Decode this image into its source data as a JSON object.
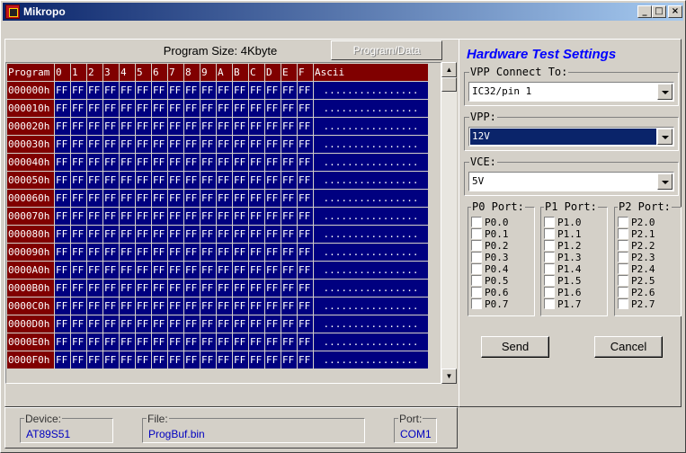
{
  "window": {
    "title": "Mikropo"
  },
  "program": {
    "size_label": "Program Size: 4Kbyte",
    "mode_button": "Program/Data",
    "headers": [
      "Program",
      "0",
      "1",
      "2",
      "3",
      "4",
      "5",
      "6",
      "7",
      "8",
      "9",
      "A",
      "B",
      "C",
      "D",
      "E",
      "F",
      "Ascii"
    ],
    "rows": [
      {
        "addr": "000000h",
        "bytes": [
          "FF",
          "FF",
          "FF",
          "FF",
          "FF",
          "FF",
          "FF",
          "FF",
          "FF",
          "FF",
          "FF",
          "FF",
          "FF",
          "FF",
          "FF",
          "FF"
        ],
        "ascii": "................"
      },
      {
        "addr": "000010h",
        "bytes": [
          "FF",
          "FF",
          "FF",
          "FF",
          "FF",
          "FF",
          "FF",
          "FF",
          "FF",
          "FF",
          "FF",
          "FF",
          "FF",
          "FF",
          "FF",
          "FF"
        ],
        "ascii": "................"
      },
      {
        "addr": "000020h",
        "bytes": [
          "FF",
          "FF",
          "FF",
          "FF",
          "FF",
          "FF",
          "FF",
          "FF",
          "FF",
          "FF",
          "FF",
          "FF",
          "FF",
          "FF",
          "FF",
          "FF"
        ],
        "ascii": "................"
      },
      {
        "addr": "000030h",
        "bytes": [
          "FF",
          "FF",
          "FF",
          "FF",
          "FF",
          "FF",
          "FF",
          "FF",
          "FF",
          "FF",
          "FF",
          "FF",
          "FF",
          "FF",
          "FF",
          "FF"
        ],
        "ascii": "................"
      },
      {
        "addr": "000040h",
        "bytes": [
          "FF",
          "FF",
          "FF",
          "FF",
          "FF",
          "FF",
          "FF",
          "FF",
          "FF",
          "FF",
          "FF",
          "FF",
          "FF",
          "FF",
          "FF",
          "FF"
        ],
        "ascii": "................"
      },
      {
        "addr": "000050h",
        "bytes": [
          "FF",
          "FF",
          "FF",
          "FF",
          "FF",
          "FF",
          "FF",
          "FF",
          "FF",
          "FF",
          "FF",
          "FF",
          "FF",
          "FF",
          "FF",
          "FF"
        ],
        "ascii": "................"
      },
      {
        "addr": "000060h",
        "bytes": [
          "FF",
          "FF",
          "FF",
          "FF",
          "FF",
          "FF",
          "FF",
          "FF",
          "FF",
          "FF",
          "FF",
          "FF",
          "FF",
          "FF",
          "FF",
          "FF"
        ],
        "ascii": "................"
      },
      {
        "addr": "000070h",
        "bytes": [
          "FF",
          "FF",
          "FF",
          "FF",
          "FF",
          "FF",
          "FF",
          "FF",
          "FF",
          "FF",
          "FF",
          "FF",
          "FF",
          "FF",
          "FF",
          "FF"
        ],
        "ascii": "................"
      },
      {
        "addr": "000080h",
        "bytes": [
          "FF",
          "FF",
          "FF",
          "FF",
          "FF",
          "FF",
          "FF",
          "FF",
          "FF",
          "FF",
          "FF",
          "FF",
          "FF",
          "FF",
          "FF",
          "FF"
        ],
        "ascii": "................"
      },
      {
        "addr": "000090h",
        "bytes": [
          "FF",
          "FF",
          "FF",
          "FF",
          "FF",
          "FF",
          "FF",
          "FF",
          "FF",
          "FF",
          "FF",
          "FF",
          "FF",
          "FF",
          "FF",
          "FF"
        ],
        "ascii": "................"
      },
      {
        "addr": "0000A0h",
        "bytes": [
          "FF",
          "FF",
          "FF",
          "FF",
          "FF",
          "FF",
          "FF",
          "FF",
          "FF",
          "FF",
          "FF",
          "FF",
          "FF",
          "FF",
          "FF",
          "FF"
        ],
        "ascii": "................"
      },
      {
        "addr": "0000B0h",
        "bytes": [
          "FF",
          "FF",
          "FF",
          "FF",
          "FF",
          "FF",
          "FF",
          "FF",
          "FF",
          "FF",
          "FF",
          "FF",
          "FF",
          "FF",
          "FF",
          "FF"
        ],
        "ascii": "................"
      },
      {
        "addr": "0000C0h",
        "bytes": [
          "FF",
          "FF",
          "FF",
          "FF",
          "FF",
          "FF",
          "FF",
          "FF",
          "FF",
          "FF",
          "FF",
          "FF",
          "FF",
          "FF",
          "FF",
          "FF"
        ],
        "ascii": "................"
      },
      {
        "addr": "0000D0h",
        "bytes": [
          "FF",
          "FF",
          "FF",
          "FF",
          "FF",
          "FF",
          "FF",
          "FF",
          "FF",
          "FF",
          "FF",
          "FF",
          "FF",
          "FF",
          "FF",
          "FF"
        ],
        "ascii": "................"
      },
      {
        "addr": "0000E0h",
        "bytes": [
          "FF",
          "FF",
          "FF",
          "FF",
          "FF",
          "FF",
          "FF",
          "FF",
          "FF",
          "FF",
          "FF",
          "FF",
          "FF",
          "FF",
          "FF",
          "FF"
        ],
        "ascii": "................"
      },
      {
        "addr": "0000F0h",
        "bytes": [
          "FF",
          "FF",
          "FF",
          "FF",
          "FF",
          "FF",
          "FF",
          "FF",
          "FF",
          "FF",
          "FF",
          "FF",
          "FF",
          "FF",
          "FF",
          "FF"
        ],
        "ascii": "................"
      }
    ]
  },
  "info": {
    "device_label": "Device:",
    "device_value": "AT89S51",
    "file_label": "File:",
    "file_value": "ProgBuf.bin",
    "port_label": "Port:",
    "port_value": "COM1"
  },
  "hardware": {
    "title": "Hardware Test Settings",
    "vpp_connect_label": "VPP Connect To:",
    "vpp_connect_value": "IC32/pin 1",
    "vpp_label": "VPP:",
    "vpp_value": "12V",
    "vce_label": "VCE:",
    "vce_value": "5V",
    "ports": [
      {
        "label": "P0 Port:",
        "pins": [
          "P0.0",
          "P0.1",
          "P0.2",
          "P0.3",
          "P0.4",
          "P0.5",
          "P0.6",
          "P0.7"
        ]
      },
      {
        "label": "P1 Port:",
        "pins": [
          "P1.0",
          "P1.1",
          "P1.2",
          "P1.3",
          "P1.4",
          "P1.5",
          "P1.6",
          "P1.7"
        ]
      },
      {
        "label": "P2 Port:",
        "pins": [
          "P2.0",
          "P2.1",
          "P2.2",
          "P2.3",
          "P2.4",
          "P2.5",
          "P2.6",
          "P2.7"
        ]
      }
    ],
    "send_label": "Send",
    "cancel_label": "Cancel"
  },
  "icons": {
    "app": "chip-icon",
    "minimize": "minimize-icon",
    "maximize": "maximize-icon",
    "close": "close-icon"
  }
}
